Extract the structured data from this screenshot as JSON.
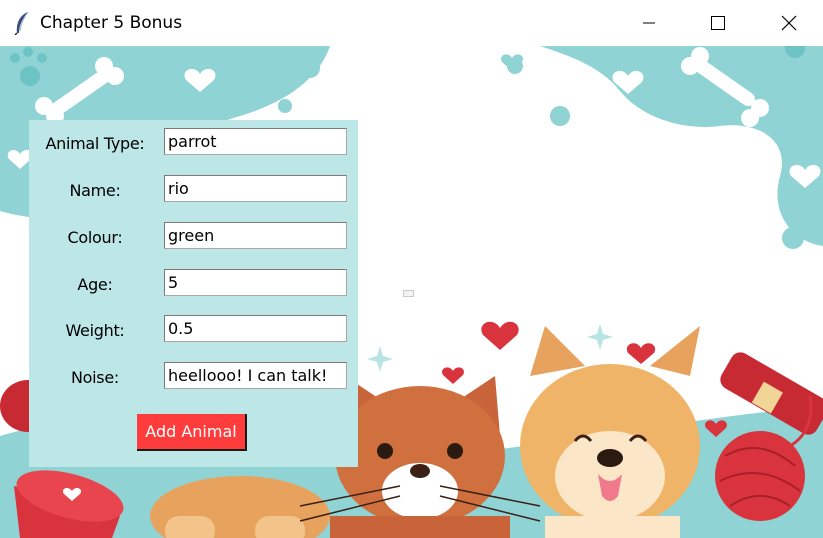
{
  "window": {
    "title": "Chapter 5 Bonus",
    "app_icon": "feather-icon",
    "controls": [
      "minimize-icon",
      "maximize-icon",
      "close-icon"
    ]
  },
  "form": {
    "fields": [
      {
        "label": "Animal Type:",
        "value": "parrot"
      },
      {
        "label": "Name:",
        "value": "rio"
      },
      {
        "label": "Colour:",
        "value": "green"
      },
      {
        "label": "Age:",
        "value": "5"
      },
      {
        "label": "Weight:",
        "value": "0.5"
      },
      {
        "label": "Noise:",
        "value": "heellooo! I can talk!"
      }
    ],
    "submit_label": "Add Animal"
  },
  "colors": {
    "panel": "#bde6e6",
    "teal": "#8fd3d4",
    "button": "#ff3c3c"
  }
}
